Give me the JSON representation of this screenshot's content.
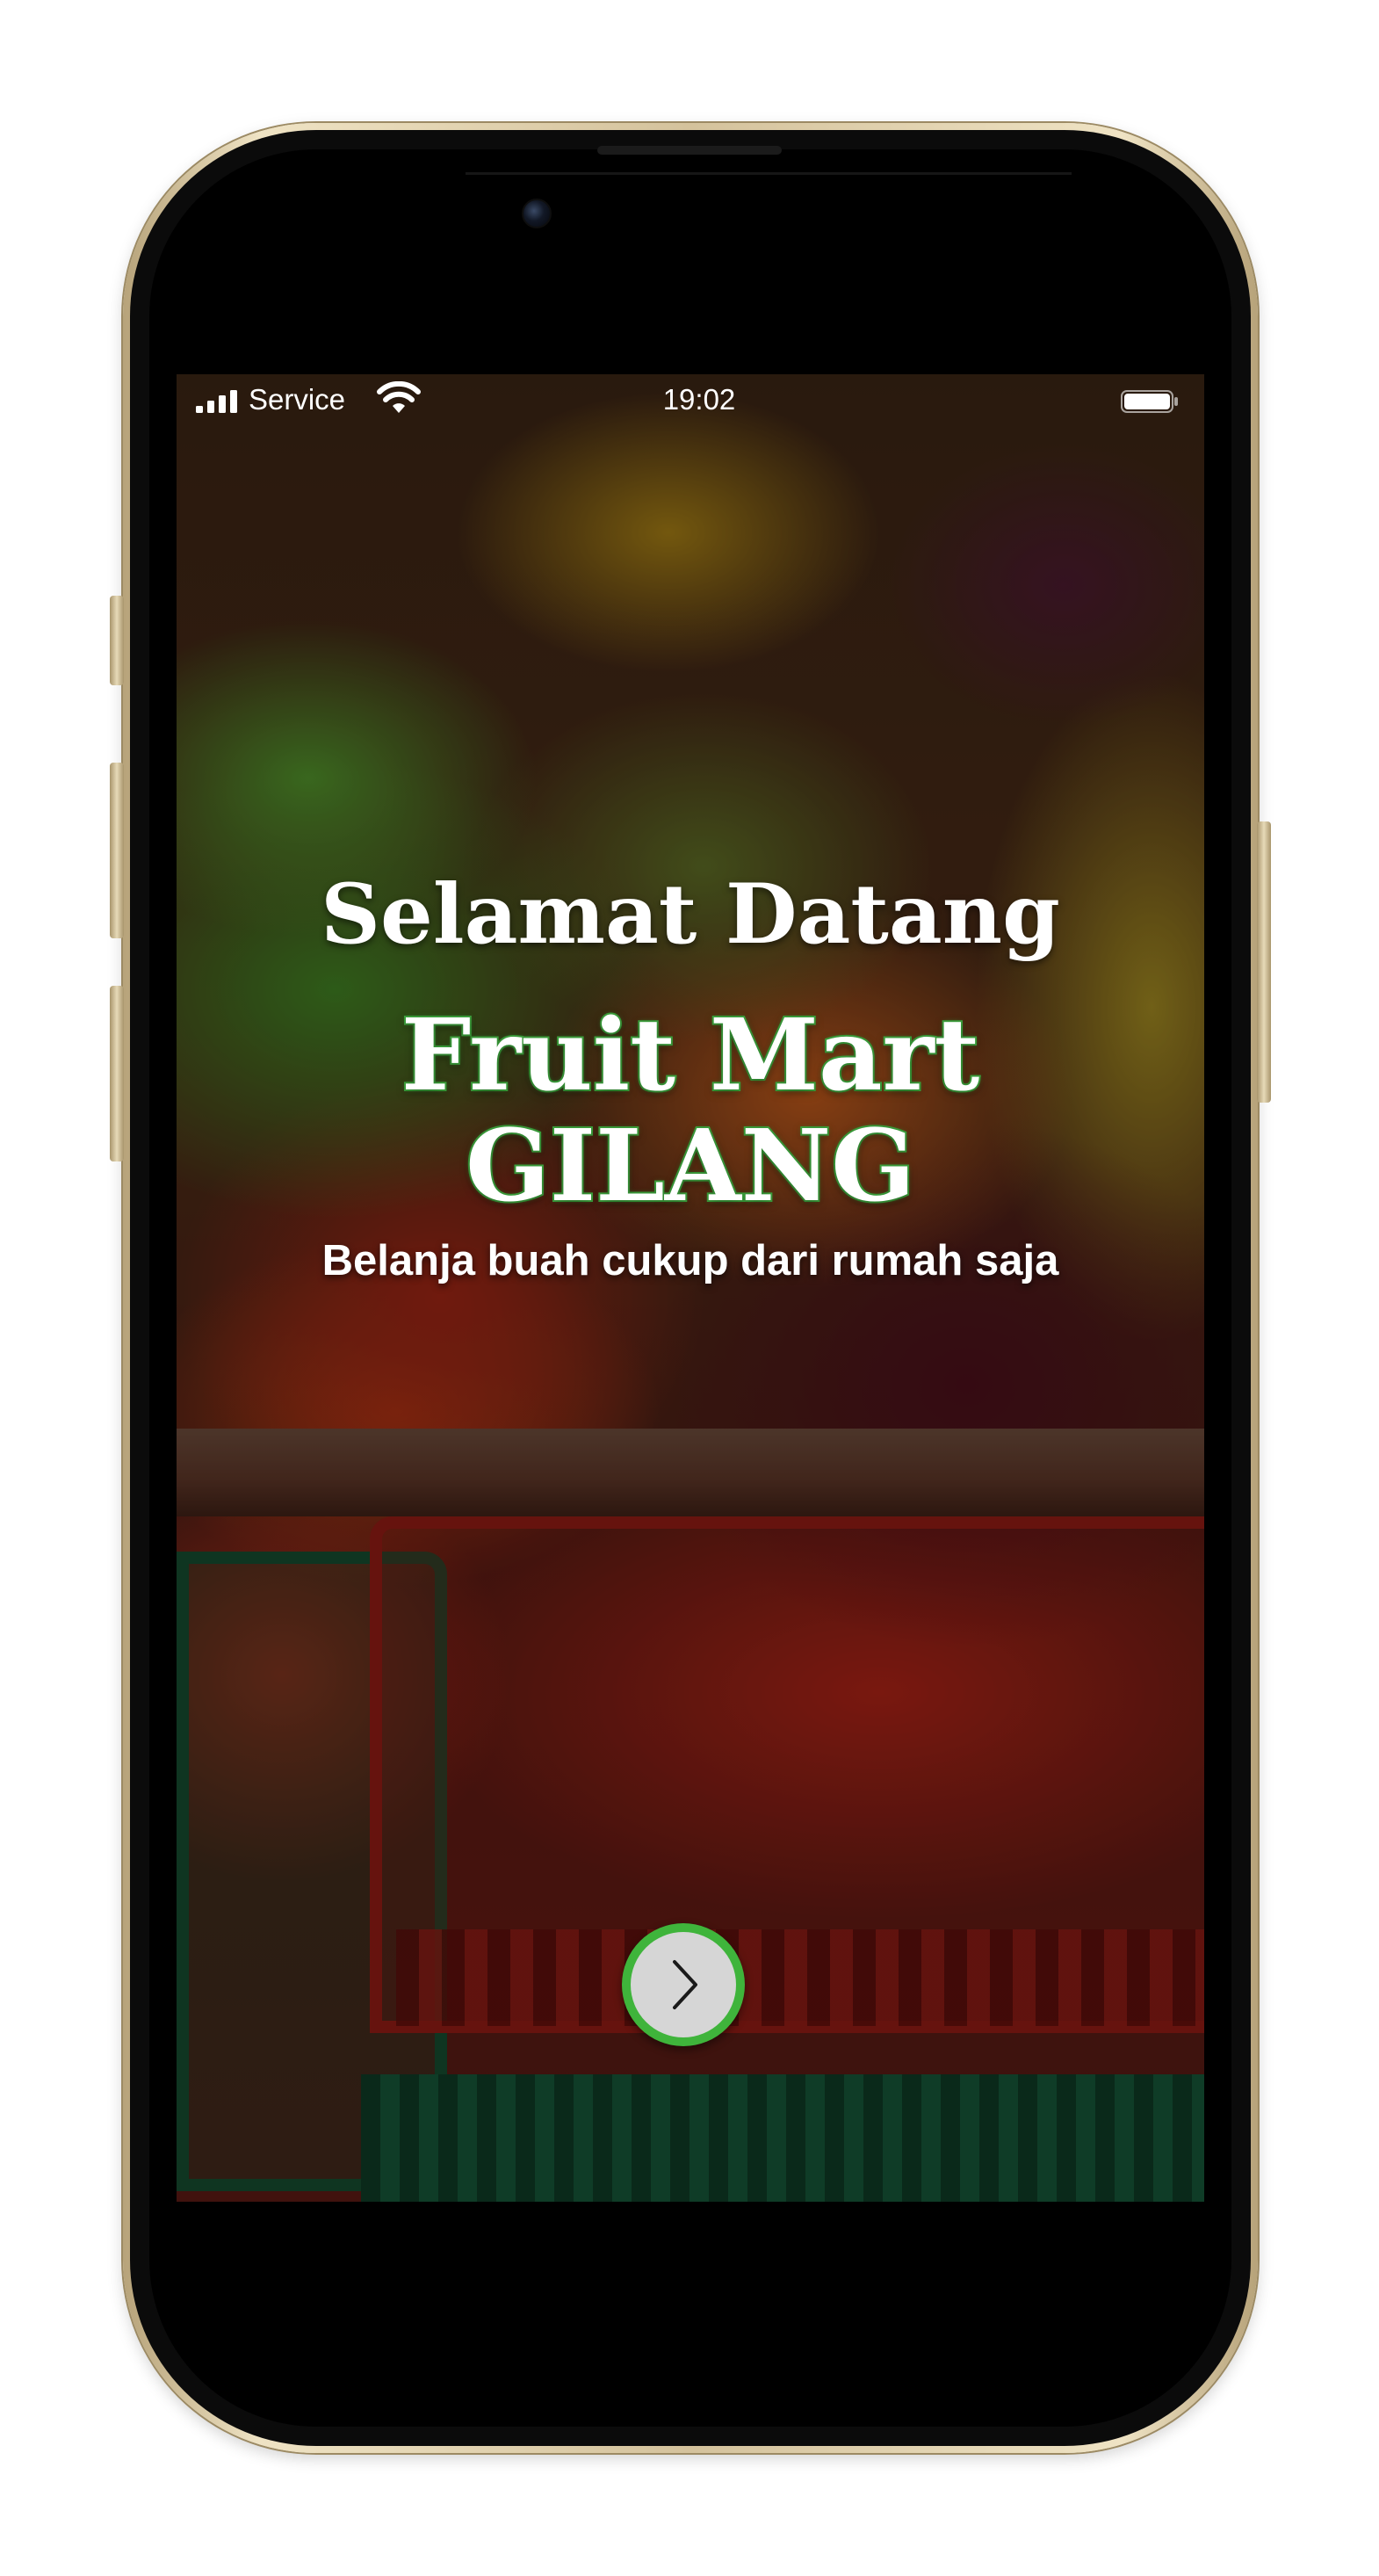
{
  "status_bar": {
    "carrier": "Service",
    "time": "19:02",
    "signal_icon": "cellular-signal-icon",
    "wifi_icon": "wifi-icon",
    "battery_icon": "battery-icon"
  },
  "hero": {
    "welcome": "Selamat Datang",
    "brand_line1": "Fruit Mart",
    "brand_line2": "GILANG",
    "tagline": "Belanja buah cukup dari rumah saja"
  },
  "next_button": {
    "icon": "chevron-right-icon"
  },
  "colors": {
    "accent_green": "#3fb43b",
    "button_fill": "#d6d6d6",
    "text": "#ffffff"
  }
}
